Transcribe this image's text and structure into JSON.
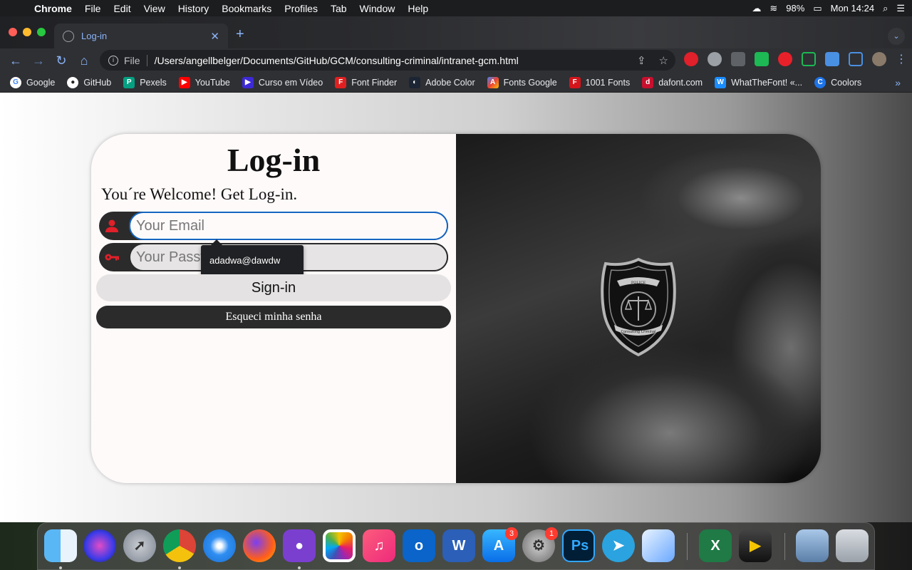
{
  "menubar": {
    "app": "Chrome",
    "items": [
      "File",
      "Edit",
      "View",
      "History",
      "Bookmarks",
      "Profiles",
      "Tab",
      "Window",
      "Help"
    ],
    "battery": "98%",
    "clock": "Mon 14:24"
  },
  "browser": {
    "tab_title": "Log-in",
    "omnibox_scheme": "File",
    "omnibox_url": "/Users/angellbelger/Documents/GitHub/GCM/consulting-criminal/intranet-gcm.html",
    "bookmarks": [
      {
        "label": "Google",
        "icon": "google-icon",
        "color": "#ffffff"
      },
      {
        "label": "GitHub",
        "icon": "github-icon",
        "color": "#ffffff"
      },
      {
        "label": "Pexels",
        "icon": "pexels-icon",
        "color": "#05a081"
      },
      {
        "label": "YouTube",
        "icon": "youtube-icon",
        "color": "#ff0000"
      },
      {
        "label": "Curso em Vídeo",
        "icon": "curso-icon",
        "color": "#3d2ad6"
      },
      {
        "label": "Font Finder",
        "icon": "fontfinder-icon",
        "color": "#e02020"
      },
      {
        "label": "Adobe Color",
        "icon": "adobecolor-icon",
        "color": "#1c2533"
      },
      {
        "label": "Fonts Google",
        "icon": "fontsgoogle-icon",
        "color": "#4285f4"
      },
      {
        "label": "1001 Fonts",
        "icon": "1001fonts-icon",
        "color": "#d4151b"
      },
      {
        "label": "dafont.com",
        "icon": "dafont-icon",
        "color": "#c8102e"
      },
      {
        "label": "WhatTheFont! «...",
        "icon": "whatthefont-icon",
        "color": "#1a8cff"
      },
      {
        "label": "Coolors",
        "icon": "coolors-icon",
        "color": "#1e73e8"
      }
    ]
  },
  "login": {
    "title": "Log-in",
    "welcome": "You´re Welcome! Get Log-in.",
    "email_placeholder": "Your Email",
    "password_placeholder": "Your Password",
    "autofill_suggestion": "adadwa@dawdw",
    "signin_label": "Sign-in",
    "forgot_label": "Esqueci minha senha",
    "icon_color": "#e0202a",
    "badge_top_text": "POLICE",
    "badge_bottom_text": "Consulting Criminal"
  },
  "dock": {
    "badges": {
      "appstore": "3",
      "settings": "1"
    }
  }
}
